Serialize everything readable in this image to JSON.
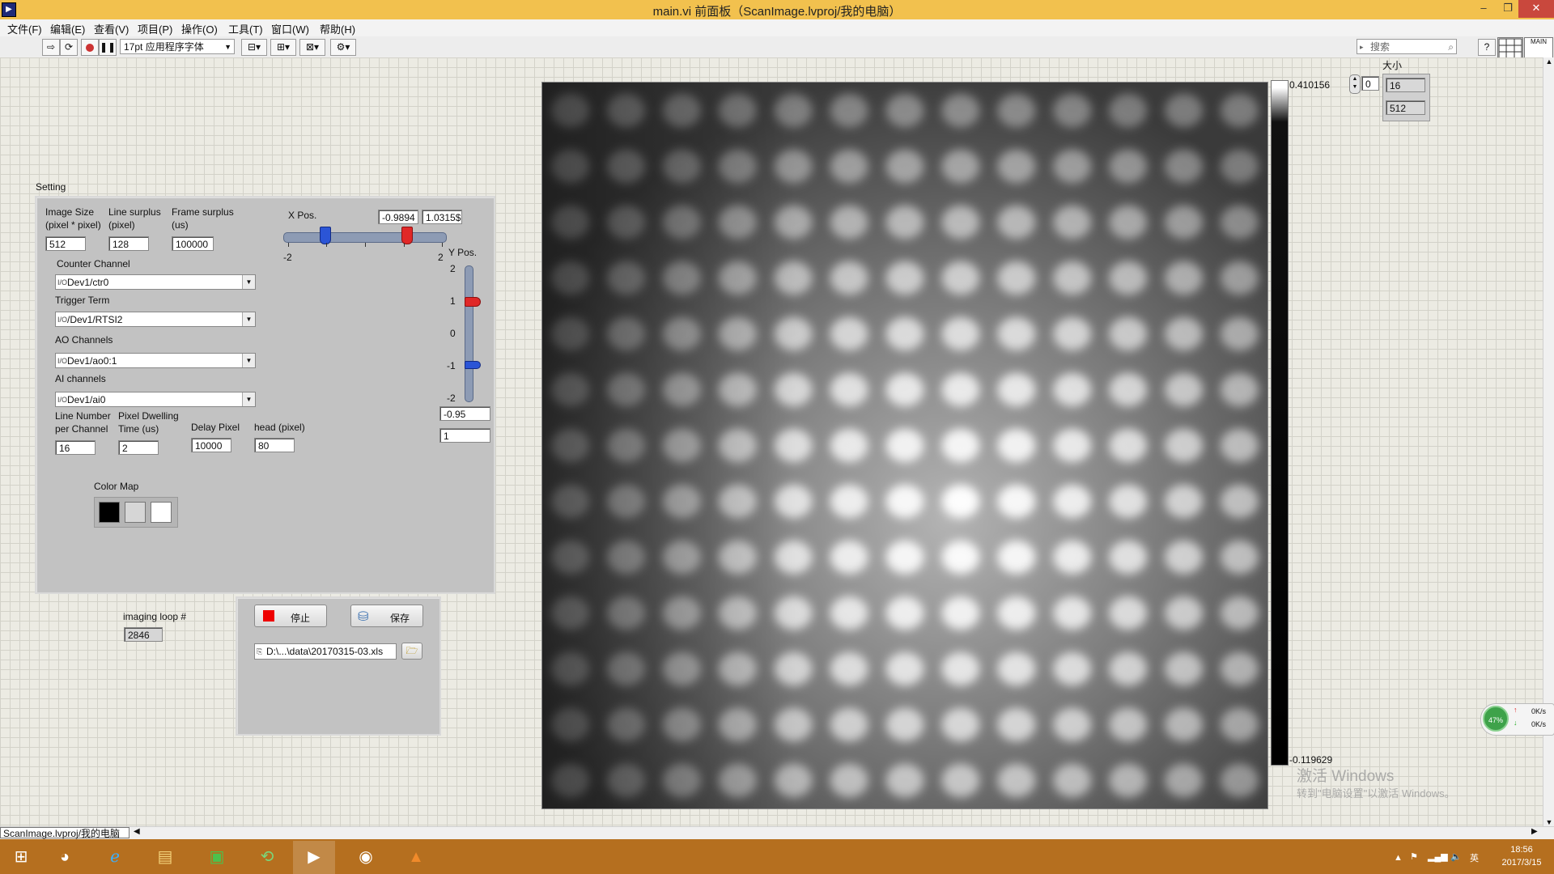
{
  "window": {
    "title": "main.vi 前面板（ScanImage.lvproj/我的电脑）",
    "app_icon": "labview-icon"
  },
  "menu": [
    "文件(F)",
    "编辑(E)",
    "查看(V)",
    "项目(P)",
    "操作(O)",
    "工具(T)",
    "窗口(W)",
    "帮助(H)"
  ],
  "toolbar": {
    "font": "17pt 应用程序字体",
    "search_placeholder": "搜索",
    "vi_icon_label": "MAIN"
  },
  "setting": {
    "caption": "Setting",
    "image_size_label": "Image Size (pixel * pixel)",
    "image_size": "512",
    "line_surplus_label": "Line surplus (pixel)",
    "line_surplus": "128",
    "frame_surplus_label": "Frame surplus (us)",
    "frame_surplus": "100000",
    "counter_channel_label": "Counter Channel",
    "counter_channel": "Dev1/ctr0",
    "trigger_term_label": "Trigger Term",
    "trigger_term": "/Dev1/RTSI2",
    "ao_channels_label": "AO Channels",
    "ao_channels": "Dev1/ao0:1",
    "ai_channels_label": "AI channels",
    "ai_channels": "Dev1/ai0",
    "line_number_label": "Line Number per Channel",
    "line_number": "16",
    "pixel_dwelling_label": "Pixel Dwelling Time (us)",
    "pixel_dwelling": "2",
    "delay_pixel_label": "Delay Pixel",
    "delay_pixel": "10000",
    "head_label": "head (pixel)",
    "head": "80",
    "color_map_label": "Color Map",
    "color_map": [
      "#000000",
      "#d6d6d6",
      "#ffffff"
    ]
  },
  "xpos": {
    "label": "X Pos.",
    "min_value": "-0.9894",
    "max_value": "1.0315$",
    "scale_min": "-2",
    "scale_max": "2",
    "range": [
      -2,
      2
    ],
    "low": -0.99,
    "high": 1.03
  },
  "ypos": {
    "label": "Y Pos.",
    "ticks": [
      "2",
      "1",
      "0",
      "-1",
      "-2"
    ],
    "range": [
      -2,
      2
    ],
    "high": 1,
    "low": -0.95,
    "low_value": "-0.95",
    "high_value": "1"
  },
  "loop": {
    "label": "imaging loop #",
    "value": "2846"
  },
  "controls": {
    "stop_label": "停止",
    "save_label": "保存",
    "file_path": "D:\\...\\data\\20170315-03.xls"
  },
  "colorbar": {
    "max": "0.410156",
    "min": "-0.119629"
  },
  "size": {
    "label": "大小",
    "index": "0",
    "rows": "16",
    "cols": "512"
  },
  "status": {
    "project": "ScanImage.lvproj/我的电脑"
  },
  "watermark": {
    "line1": "激活 Windows",
    "line2": "转到\"电脑设置\"以激活 Windows。"
  },
  "net_widget": {
    "cpu": "47%",
    "up": "0K/s",
    "down": "0K/s"
  },
  "taskbar": {
    "time": "18:56",
    "date": "2017/3/15",
    "ime": "英"
  }
}
